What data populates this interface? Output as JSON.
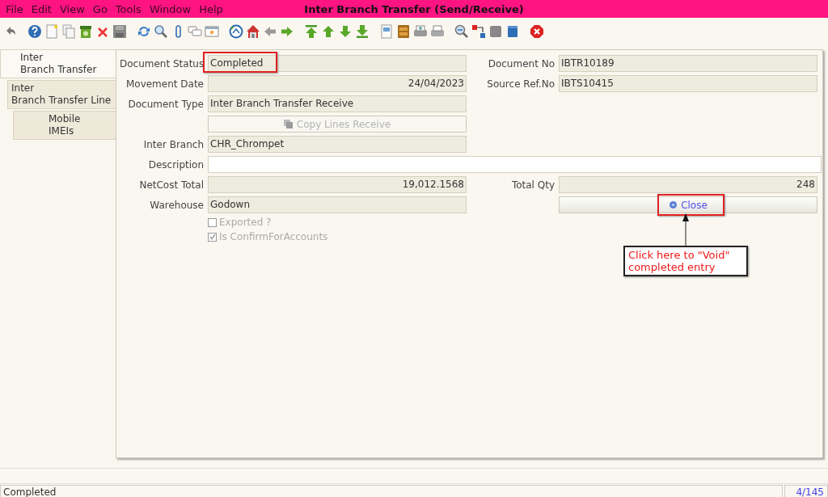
{
  "window": {
    "title": "Inter Branch Transfer (Send/Receive)"
  },
  "menu": [
    "File",
    "Edit",
    "View",
    "Go",
    "Tools",
    "Window",
    "Help"
  ],
  "tabs": [
    {
      "label": "Inter\nBranch Transfer",
      "selected": true,
      "children": [
        {
          "label": "Inter\nBranch Transfer Line",
          "selected": false,
          "children": [
            {
              "label": "Mobile\nIMEIs",
              "selected": false
            }
          ]
        }
      ]
    }
  ],
  "form": {
    "rows": [
      {
        "items": [
          {
            "kind": "text",
            "label": "Document Status",
            "value": "Completed",
            "readonly": true,
            "highlighted": true
          },
          {
            "kind": "text",
            "label": "Document No",
            "value": "IBTR10189",
            "readonly": true
          }
        ]
      },
      {
        "items": [
          {
            "kind": "number",
            "label": "Movement Date",
            "value": "24/04/2023",
            "readonly": true
          },
          {
            "kind": "text",
            "label": "Source Ref.No",
            "value": "IBTS10415",
            "readonly": true
          }
        ]
      },
      {
        "items": [
          {
            "kind": "text",
            "label": "Document Type",
            "value": "Inter Branch Transfer Receive",
            "readonly": true
          }
        ]
      },
      {
        "items": [
          {
            "kind": "button",
            "label": "Copy Lines Receive",
            "disabled": true
          }
        ]
      },
      {
        "items": [
          {
            "kind": "text",
            "label": "Inter Branch",
            "value": "CHR_Chrompet",
            "readonly": true
          }
        ]
      },
      {
        "items": [
          {
            "kind": "long_text",
            "label": "Description",
            "readonly": false
          }
        ]
      },
      {
        "items": [
          {
            "kind": "number",
            "label": "NetCost Total",
            "value": "19,012.1568",
            "readonly": true
          },
          {
            "kind": "number",
            "label": "Total Qty",
            "value": "248",
            "readonly": true
          }
        ]
      },
      {
        "items": [
          {
            "kind": "text",
            "label": "Warehouse",
            "value": "Godown",
            "readonly": true
          },
          {
            "kind": "button",
            "label": "Close",
            "disabled": false,
            "highlighted": true
          }
        ]
      },
      {
        "items": [
          {
            "kind": "checkbox",
            "label": "Exported ?",
            "checked": false,
            "disabled": true
          }
        ]
      },
      {
        "items": [
          {
            "kind": "checkbox",
            "label": "Is ConfirmForAccounts",
            "checked": true,
            "disabled": true
          }
        ]
      }
    ]
  },
  "callout": {
    "text": "Click here to \"Void\" completed entry"
  },
  "status_bar": {
    "message": "Completed",
    "record": "4/145"
  }
}
